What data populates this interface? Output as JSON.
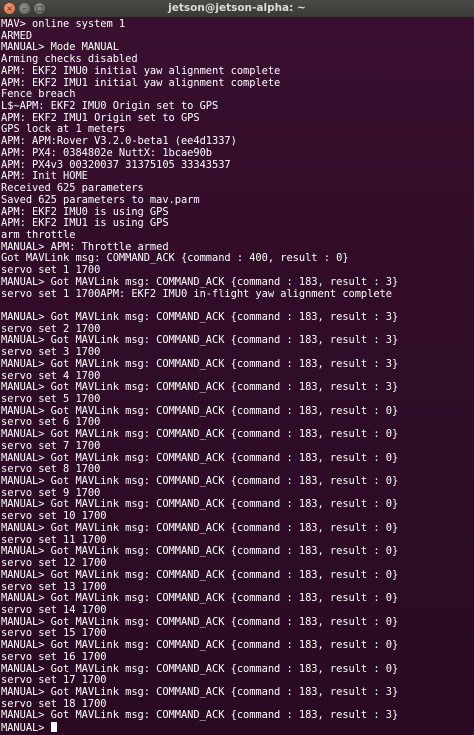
{
  "window": {
    "title": "jetson@jetson-alpha: ~",
    "close_glyph": "×",
    "minimize_glyph": "–",
    "maximize_glyph": "□"
  },
  "terminal": {
    "lines": [
      "MAV> online system 1",
      "ARMED",
      "MANUAL> Mode MANUAL",
      "Arming checks disabled",
      "APM: EKF2 IMU0 initial yaw alignment complete",
      "APM: EKF2 IMU1 initial yaw alignment complete",
      "Fence breach",
      "L$~APM: EKF2 IMU0 Origin set to GPS",
      "APM: EKF2 IMU1 Origin set to GPS",
      "GPS lock at 1 meters",
      "APM: APM:Rover V3.2.0-beta1 (ee4d1337)",
      "APM: PX4: 0384802e NuttX: 1bcae90b",
      "APM: PX4v3 00320037 31375105 33343537",
      "APM: Init HOME",
      "Received 625 parameters",
      "Saved 625 parameters to mav.parm",
      "APM: EKF2 IMU0 is using GPS",
      "APM: EKF2 IMU1 is using GPS",
      "arm throttle",
      "MANUAL> APM: Throttle armed",
      "Got MAVLink msg: COMMAND_ACK {command : 400, result : 0}",
      "servo set 1 1700",
      "MANUAL> Got MAVLink msg: COMMAND_ACK {command : 183, result : 3}",
      "servo set 1 1700APM: EKF2 IMU0 in-flight yaw alignment complete",
      "",
      "MANUAL> Got MAVLink msg: COMMAND_ACK {command : 183, result : 3}",
      "servo set 2 1700",
      "MANUAL> Got MAVLink msg: COMMAND_ACK {command : 183, result : 3}",
      "servo set 3 1700",
      "MANUAL> Got MAVLink msg: COMMAND_ACK {command : 183, result : 3}",
      "servo set 4 1700",
      "MANUAL> Got MAVLink msg: COMMAND_ACK {command : 183, result : 3}",
      "servo set 5 1700",
      "MANUAL> Got MAVLink msg: COMMAND_ACK {command : 183, result : 0}",
      "servo set 6 1700",
      "MANUAL> Got MAVLink msg: COMMAND_ACK {command : 183, result : 0}",
      "servo set 7 1700",
      "MANUAL> Got MAVLink msg: COMMAND_ACK {command : 183, result : 0}",
      "servo set 8 1700",
      "MANUAL> Got MAVLink msg: COMMAND_ACK {command : 183, result : 0}",
      "servo set 9 1700",
      "MANUAL> Got MAVLink msg: COMMAND_ACK {command : 183, result : 0}",
      "servo set 10 1700",
      "MANUAL> Got MAVLink msg: COMMAND_ACK {command : 183, result : 0}",
      "servo set 11 1700",
      "MANUAL> Got MAVLink msg: COMMAND_ACK {command : 183, result : 0}",
      "servo set 12 1700",
      "MANUAL> Got MAVLink msg: COMMAND_ACK {command : 183, result : 0}",
      "servo set 13 1700",
      "MANUAL> Got MAVLink msg: COMMAND_ACK {command : 183, result : 0}",
      "servo set 14 1700",
      "MANUAL> Got MAVLink msg: COMMAND_ACK {command : 183, result : 0}",
      "servo set 15 1700",
      "MANUAL> Got MAVLink msg: COMMAND_ACK {command : 183, result : 0}",
      "servo set 16 1700",
      "MANUAL> Got MAVLink msg: COMMAND_ACK {command : 183, result : 0}",
      "servo set 17 1700",
      "MANUAL> Got MAVLink msg: COMMAND_ACK {command : 183, result : 3}",
      "servo set 18 1700",
      "MANUAL> Got MAVLink msg: COMMAND_ACK {command : 183, result : 3}"
    ],
    "prompt": "MANUAL> "
  }
}
